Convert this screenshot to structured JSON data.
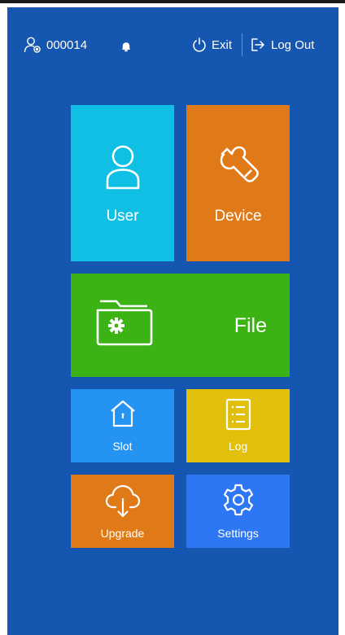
{
  "header": {
    "user_id": "000014",
    "exit_label": "Exit",
    "logout_label": "Log Out"
  },
  "tiles": {
    "user": "User",
    "device": "Device",
    "file": "File",
    "slot": "Slot",
    "log": "Log",
    "upgrade": "Upgrade",
    "settings": "Settings"
  },
  "icons": {
    "user_id": "user-settings-icon",
    "notification": "bell-icon",
    "exit": "power-icon",
    "logout": "logout-arrow-icon",
    "user": "person-icon",
    "device": "wrench-icon",
    "file": "folder-gear-icon",
    "slot": "house-icon",
    "log": "list-document-icon",
    "upgrade": "cloud-download-icon",
    "settings": "gear-icon"
  },
  "colors": {
    "background": "#1557b0",
    "user_tile": "#10c0e4",
    "device_tile": "#e07a18",
    "file_tile": "#3cb314",
    "slot_tile": "#2493f2",
    "log_tile": "#e2bf0a",
    "upgrade_tile": "#e07a18",
    "settings_tile": "#2d77f4"
  }
}
